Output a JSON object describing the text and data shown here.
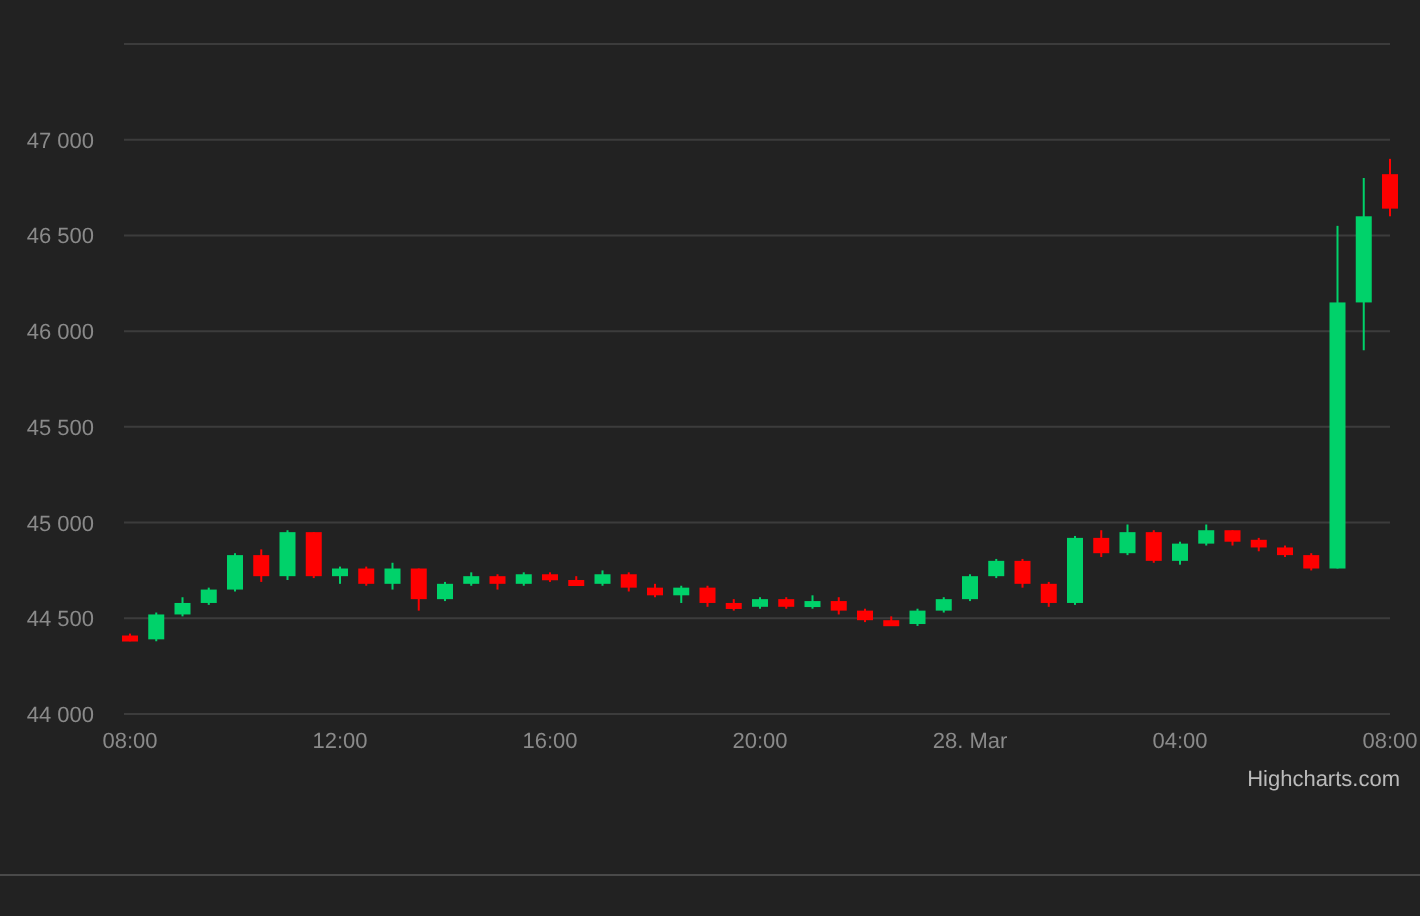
{
  "chart": {
    "chart_data": {
      "type": "candlestick",
      "ylim": [
        44000,
        47500
      ],
      "yticks": [
        {
          "value": 44000,
          "label": "44 000"
        },
        {
          "value": 44500,
          "label": "44 500"
        },
        {
          "value": 45000,
          "label": "45 000"
        },
        {
          "value": 45500,
          "label": "45 500"
        },
        {
          "value": 46000,
          "label": "46 000"
        },
        {
          "value": 46500,
          "label": "46 500"
        },
        {
          "value": 47000,
          "label": "47 000"
        }
      ],
      "grid": true,
      "categories": [
        "08:00",
        null,
        null,
        null,
        null,
        null,
        null,
        null,
        "12:00",
        null,
        null,
        null,
        null,
        null,
        null,
        null,
        "16:00",
        null,
        null,
        null,
        null,
        null,
        null,
        null,
        "20:00",
        null,
        null,
        null,
        null,
        null,
        null,
        null,
        "28. Mar",
        null,
        null,
        null,
        null,
        null,
        null,
        null,
        "04:00",
        null,
        null,
        null,
        null,
        null,
        null,
        null,
        "08:00"
      ],
      "ohlc": [
        [
          44410,
          44420,
          44380,
          44390
        ],
        [
          44390,
          44530,
          44380,
          44520
        ],
        [
          44520,
          44610,
          44510,
          44580
        ],
        [
          44580,
          44660,
          44570,
          44650
        ],
        [
          44650,
          44840,
          44640,
          44830
        ],
        [
          44830,
          44860,
          44690,
          44720
        ],
        [
          44720,
          44960,
          44700,
          44950
        ],
        [
          44950,
          44950,
          44710,
          44720
        ],
        [
          44720,
          44770,
          44680,
          44760
        ],
        [
          44760,
          44770,
          44670,
          44680
        ],
        [
          44680,
          44790,
          44650,
          44760
        ],
        [
          44760,
          44760,
          44540,
          44600
        ],
        [
          44600,
          44690,
          44590,
          44680
        ],
        [
          44680,
          44740,
          44670,
          44720
        ],
        [
          44720,
          44730,
          44650,
          44680
        ],
        [
          44680,
          44740,
          44670,
          44730
        ],
        [
          44730,
          44740,
          44690,
          44700
        ],
        [
          44700,
          44720,
          44670,
          44680
        ],
        [
          44680,
          44750,
          44670,
          44730
        ],
        [
          44730,
          44740,
          44640,
          44660
        ],
        [
          44660,
          44680,
          44610,
          44620
        ],
        [
          44620,
          44670,
          44580,
          44660
        ],
        [
          44660,
          44670,
          44560,
          44580
        ],
        [
          44580,
          44600,
          44540,
          44560
        ],
        [
          44560,
          44610,
          44550,
          44600
        ],
        [
          44600,
          44610,
          44550,
          44560
        ],
        [
          44560,
          44620,
          44550,
          44590
        ],
        [
          44590,
          44610,
          44520,
          44540
        ],
        [
          44540,
          44550,
          44480,
          44490
        ],
        [
          44490,
          44510,
          44460,
          44470
        ],
        [
          44470,
          44550,
          44460,
          44540
        ],
        [
          44540,
          44610,
          44530,
          44600
        ],
        [
          44600,
          44730,
          44590,
          44720
        ],
        [
          44720,
          44810,
          44710,
          44800
        ],
        [
          44800,
          44810,
          44660,
          44680
        ],
        [
          44680,
          44690,
          44560,
          44580
        ],
        [
          44580,
          44930,
          44570,
          44920
        ],
        [
          44920,
          44960,
          44820,
          44840
        ],
        [
          44840,
          44990,
          44830,
          44950
        ],
        [
          44950,
          44960,
          44790,
          44800
        ],
        [
          44800,
          44900,
          44780,
          44890
        ],
        [
          44890,
          44990,
          44880,
          44960
        ],
        [
          44960,
          44960,
          44880,
          44900
        ],
        [
          44910,
          44920,
          44850,
          44870
        ],
        [
          44870,
          44880,
          44820,
          44830
        ],
        [
          44830,
          44840,
          44750,
          44760
        ],
        [
          44760,
          46550,
          44760,
          46150
        ],
        [
          46150,
          46800,
          45900,
          46600
        ],
        [
          46820,
          46900,
          46600,
          46640
        ]
      ]
    },
    "credit": "Highcharts.com"
  }
}
